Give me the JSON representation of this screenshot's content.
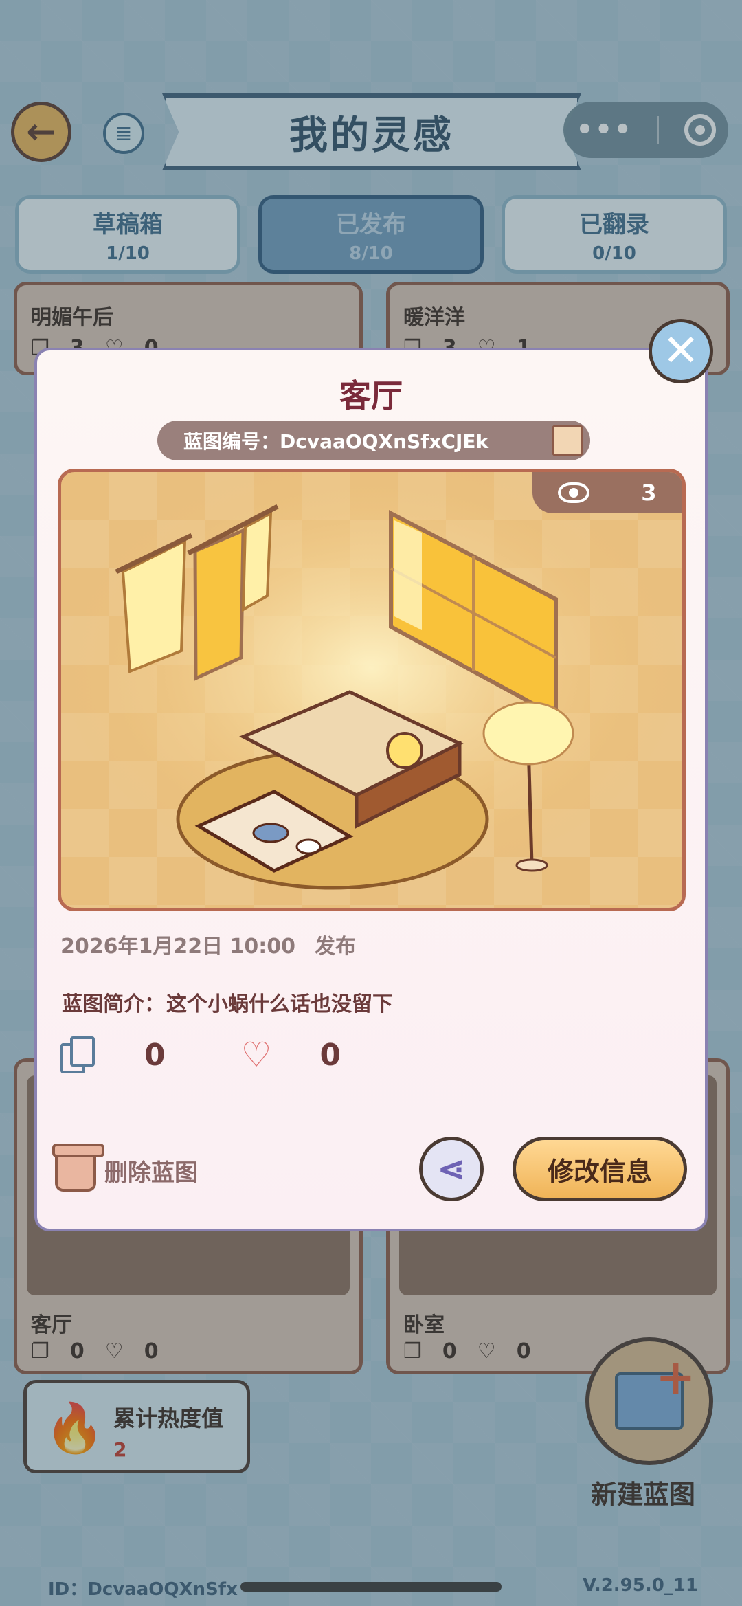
{
  "header": {
    "title": "我的灵感",
    "back_icon": "←",
    "scroll_icon": "≣",
    "menu_dots": "•••"
  },
  "tabs": [
    {
      "label": "草稿箱",
      "count": "1/10"
    },
    {
      "label": "已发布",
      "count": "8/10"
    },
    {
      "label": "已翻录",
      "count": "0/10"
    }
  ],
  "cards": [
    {
      "name": "明媚午后",
      "copies": "3",
      "likes": "0"
    },
    {
      "name": "暖洋洋",
      "copies": "3",
      "likes": "1"
    },
    {
      "name": "客厅",
      "copies": "0",
      "likes": "0"
    },
    {
      "name": "卧室",
      "copies": "0",
      "likes": "0"
    }
  ],
  "heat": {
    "label": "累计热度值",
    "value": "2"
  },
  "new_blueprint": {
    "label": "新建蓝图"
  },
  "footer": {
    "id": "ID：DcvaaOQXnSfx",
    "version": "V.2.95.0_11"
  },
  "modal": {
    "title": "客厅",
    "code": "蓝图编号：DcvaaOQXnSfxCJEk",
    "views": "3",
    "date": "2026年1月22日 10:00",
    "status": "发布",
    "intro_label": "蓝图简介：",
    "intro_text": "这个小蜗什么话也没留下",
    "copies": "0",
    "likes": "0",
    "delete_label": "删除蓝图",
    "edit_label": "修改信息",
    "close_icon": "✕",
    "share_icon": "⋖"
  }
}
